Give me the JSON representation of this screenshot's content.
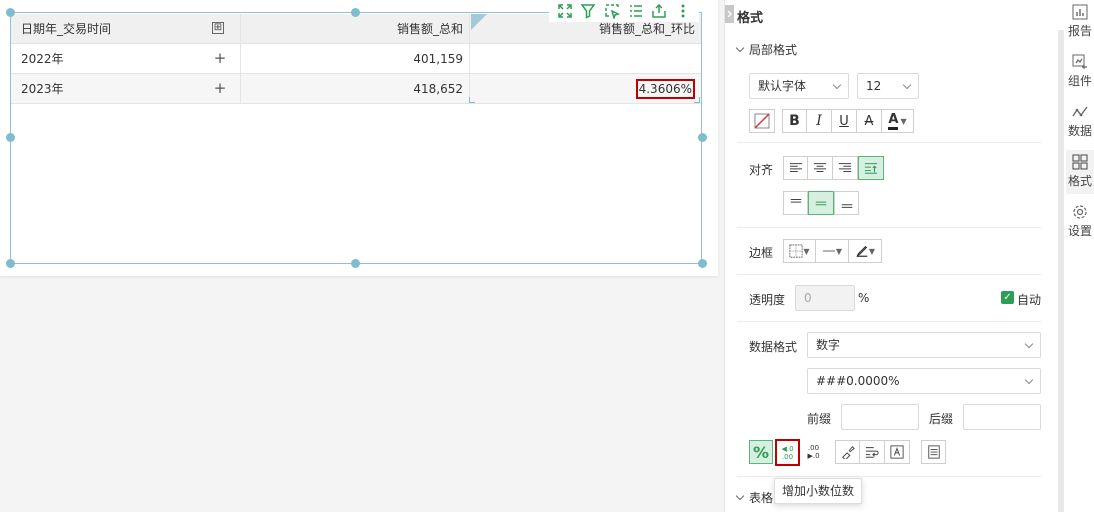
{
  "table": {
    "headers": [
      "日期年_交易时间",
      "销售额_总和",
      "销售额_总和_环比"
    ],
    "header_expand_symbol": "⊞",
    "rows": [
      {
        "date": "2022年",
        "expand": "+",
        "sales": "401,159",
        "ratio": ""
      },
      {
        "date": "2023年",
        "expand": "+",
        "sales": "418,652",
        "ratio": "4.3606%"
      }
    ]
  },
  "widget_toolbar": {
    "icons": [
      "fullscreen-icon",
      "filter-icon",
      "select-icon",
      "list-icon",
      "export-icon",
      "more-icon"
    ]
  },
  "panel": {
    "title": "格式",
    "local_format": {
      "title": "局部格式",
      "font_family": "默认字体",
      "font_size": "12",
      "style_buttons": [
        "B",
        "I",
        "U",
        "A"
      ],
      "align_label": "对齐",
      "border_label": "边框",
      "opacity_label": "透明度",
      "opacity_value": "0",
      "opacity_unit": "%",
      "auto_label": "自动",
      "auto_checked": true,
      "data_format_label": "数据格式",
      "data_format_value": "数字",
      "number_pattern": "###0.0000%",
      "prefix_label": "前缀",
      "suffix_label": "后缀",
      "prefix_value": "",
      "suffix_value": "",
      "percent_button": "%",
      "inc_decimal_top": ".0",
      "inc_decimal_bottom": ".00",
      "dec_decimal_top": ".00",
      "dec_decimal_bottom": ".0"
    },
    "table_format_title": "表格",
    "tooltip": "增加小数位数"
  },
  "side_tabs": [
    {
      "label": "报告",
      "icon": "report-icon"
    },
    {
      "label": "组件",
      "icon": "component-icon"
    },
    {
      "label": "数据",
      "icon": "data-icon"
    },
    {
      "label": "格式",
      "icon": "format-icon",
      "active": true
    },
    {
      "label": "设置",
      "icon": "settings-icon"
    }
  ],
  "colors": {
    "accent_green": "#2e9e57",
    "active_fill": "#d7efe0",
    "highlight_red": "#c00000",
    "frame_blue": "#8fc3d3"
  }
}
